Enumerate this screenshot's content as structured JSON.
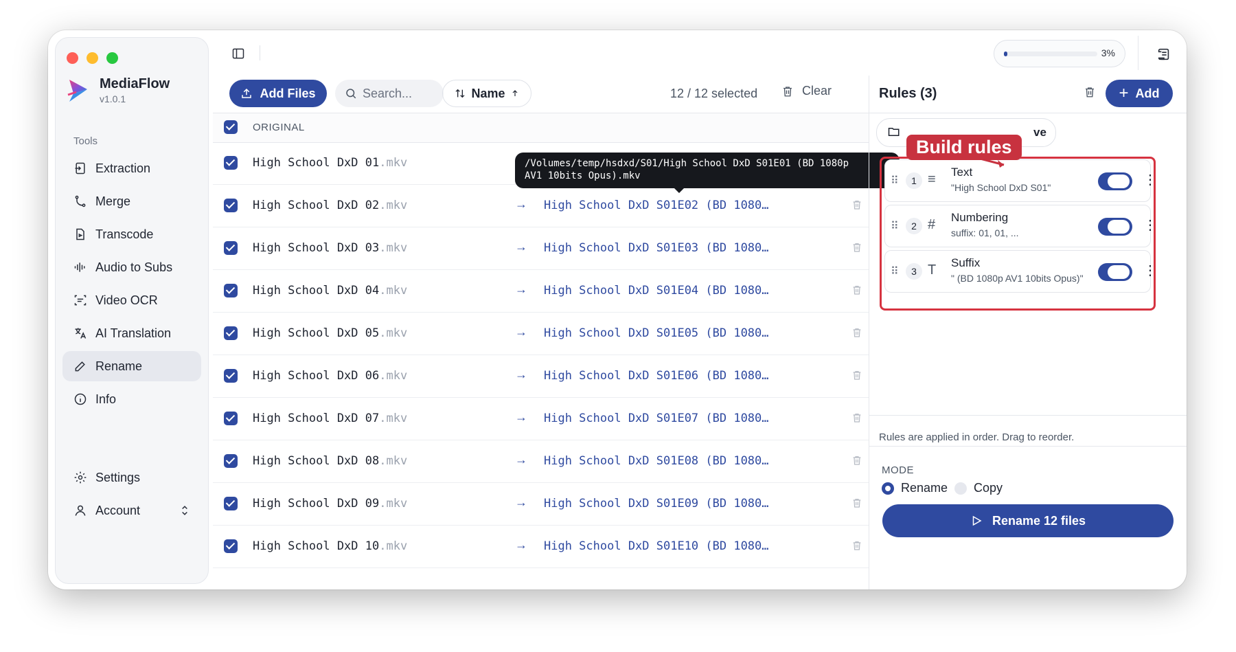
{
  "app": {
    "name": "MediaFlow",
    "version": "v1.0.1"
  },
  "sidebar": {
    "section": "Tools",
    "items": [
      {
        "label": "Extraction",
        "icon": "extract-icon"
      },
      {
        "label": "Merge",
        "icon": "merge-icon"
      },
      {
        "label": "Transcode",
        "icon": "file-icon"
      },
      {
        "label": "Audio to Subs",
        "icon": "audio-wave-icon"
      },
      {
        "label": "Video OCR",
        "icon": "scan-icon"
      },
      {
        "label": "AI Translation",
        "icon": "translate-icon"
      },
      {
        "label": "Rename",
        "icon": "pencil-icon",
        "active": true
      },
      {
        "label": "Info",
        "icon": "info-icon"
      }
    ],
    "settings": "Settings",
    "account": "Account"
  },
  "status": {
    "progress_text": "3%",
    "progress": 0.03
  },
  "toolbar": {
    "add_files": "Add Files",
    "search_placeholder": "Search...",
    "sort_label": "Name",
    "selected": "12 / 12 selected",
    "clear": "Clear"
  },
  "list": {
    "header": "ORIGINAL",
    "rows": [
      {
        "base": "High School DxD 01",
        "ext": ".mkv",
        "new": "High School DxD S01E01 (BD 1080…"
      },
      {
        "base": "High School DxD 02",
        "ext": ".mkv",
        "new": "High School DxD S01E02 (BD 1080…"
      },
      {
        "base": "High School DxD 03",
        "ext": ".mkv",
        "new": "High School DxD S01E03 (BD 1080…"
      },
      {
        "base": "High School DxD 04",
        "ext": ".mkv",
        "new": "High School DxD S01E04 (BD 1080…"
      },
      {
        "base": "High School DxD 05",
        "ext": ".mkv",
        "new": "High School DxD S01E05 (BD 1080…"
      },
      {
        "base": "High School DxD 06",
        "ext": ".mkv",
        "new": "High School DxD S01E06 (BD 1080…"
      },
      {
        "base": "High School DxD 07",
        "ext": ".mkv",
        "new": "High School DxD S01E07 (BD 1080…"
      },
      {
        "base": "High School DxD 08",
        "ext": ".mkv",
        "new": "High School DxD S01E08 (BD 1080…"
      },
      {
        "base": "High School DxD 09",
        "ext": ".mkv",
        "new": "High School DxD S01E09 (BD 1080…"
      },
      {
        "base": "High School DxD 10",
        "ext": ".mkv",
        "new": "High School DxD S01E10 (BD 1080…"
      }
    ],
    "tooltip_line1": "/Volumes/temp/hsdxd/S01/High School DxD S01E01 (BD 1080p",
    "tooltip_line2": "AV1 10bits Opus).mkv"
  },
  "rules": {
    "title": "Rules (3)",
    "add": "Add",
    "tab_suffix": "ve",
    "callout": "Build rules",
    "items": [
      {
        "num": "1",
        "type_icon": "≡",
        "name": "Text",
        "desc": "\"High School DxD S01\""
      },
      {
        "num": "2",
        "type_icon": "#",
        "name": "Numbering",
        "desc": "suffix: 01, 01, ..."
      },
      {
        "num": "3",
        "type_icon": "T",
        "name": "Suffix",
        "desc": "\" (BD 1080p AV1 10bits Opus)\""
      }
    ],
    "note": "Rules are applied in order. Drag to reorder.",
    "mode_label": "MODE",
    "mode_rename": "Rename",
    "mode_copy": "Copy",
    "action": "Rename 12 files"
  }
}
